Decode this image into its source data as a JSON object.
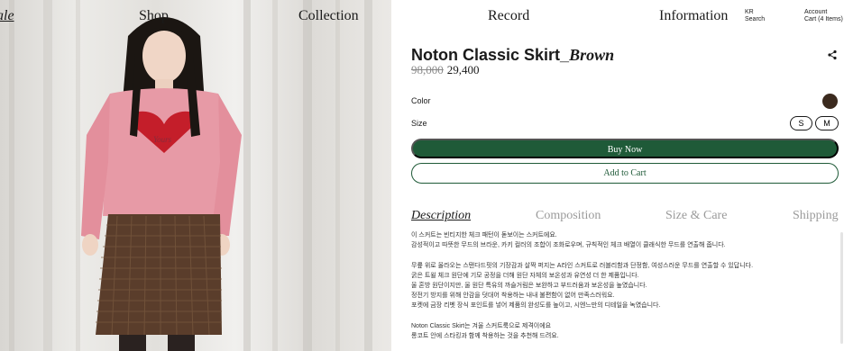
{
  "nav": {
    "sale": "ale",
    "shop": "Shop",
    "collection": "Collection",
    "record": "Record",
    "information": "Information",
    "kr": "KR",
    "search": "Search",
    "account": "Account",
    "cart": "Cart (4 Items)"
  },
  "product": {
    "title": "Noton Classic Skirt_",
    "title_italic": "Brown",
    "price_original": "98,000",
    "price_sale": "29,400",
    "color_label": "Color",
    "color_swatch": "#3b2a1e",
    "size_label": "Size",
    "sizes": [
      "S",
      "M"
    ],
    "buy_now": "Buy Now",
    "add_to_cart": "Add to Cart"
  },
  "tabs": [
    "Description",
    "Composition",
    "Size & Care",
    "Shipping"
  ],
  "description": [
    "이 스커트는 빈티지한 체크 패턴이 돋보이는 스커트에요.",
    "감성적이고 따뜻한 무드의 브라운, 카키 컬러의 조합이 조화로우며, 규칙적인 체크 배열이 클래식한 무드를 연출해 줍니다.",
    "",
    "무릎 위로 올라오는 스탠다드핏의 기장감과 살짝 퍼지는 A라인 스커트로 러블리함과 단정함, 여성스러운 무드를 연출할 수 있답니다.",
    "굵은 트윌 체크 원단에 기모 공정을 더해 원단 자체의 보온성과 유연성 더 한 제품입니다.",
    "울 혼방 원단이지만, 울 원단 특유의 까슬거림은 보완하고 부드러움과 보온성을 높였습니다.",
    "정전기 방지를 위해 안감을 덧대어 착용하는 내내 불편함이 없어 만족스러워요.",
    "포켓에 금장 리벳 장식 포인트를 넣어 제품의 완성도를 높이고, 시엔느만의 디테일을 녹였습니다.",
    "",
    "Noton Classic Skirt는 겨울 스커트룩으로 제격이에요",
    "롱코트 안에 스타킹과 함께 착용하는 것을 추천해 드려요."
  ],
  "photo": {
    "sweater_text": "Yours"
  },
  "colors": {
    "accent": "#1f5a38",
    "swatch": "#3b2a1e",
    "sweater": "#e79aa6",
    "heart": "#c41e2a",
    "skirt": "#5a3d2b"
  }
}
